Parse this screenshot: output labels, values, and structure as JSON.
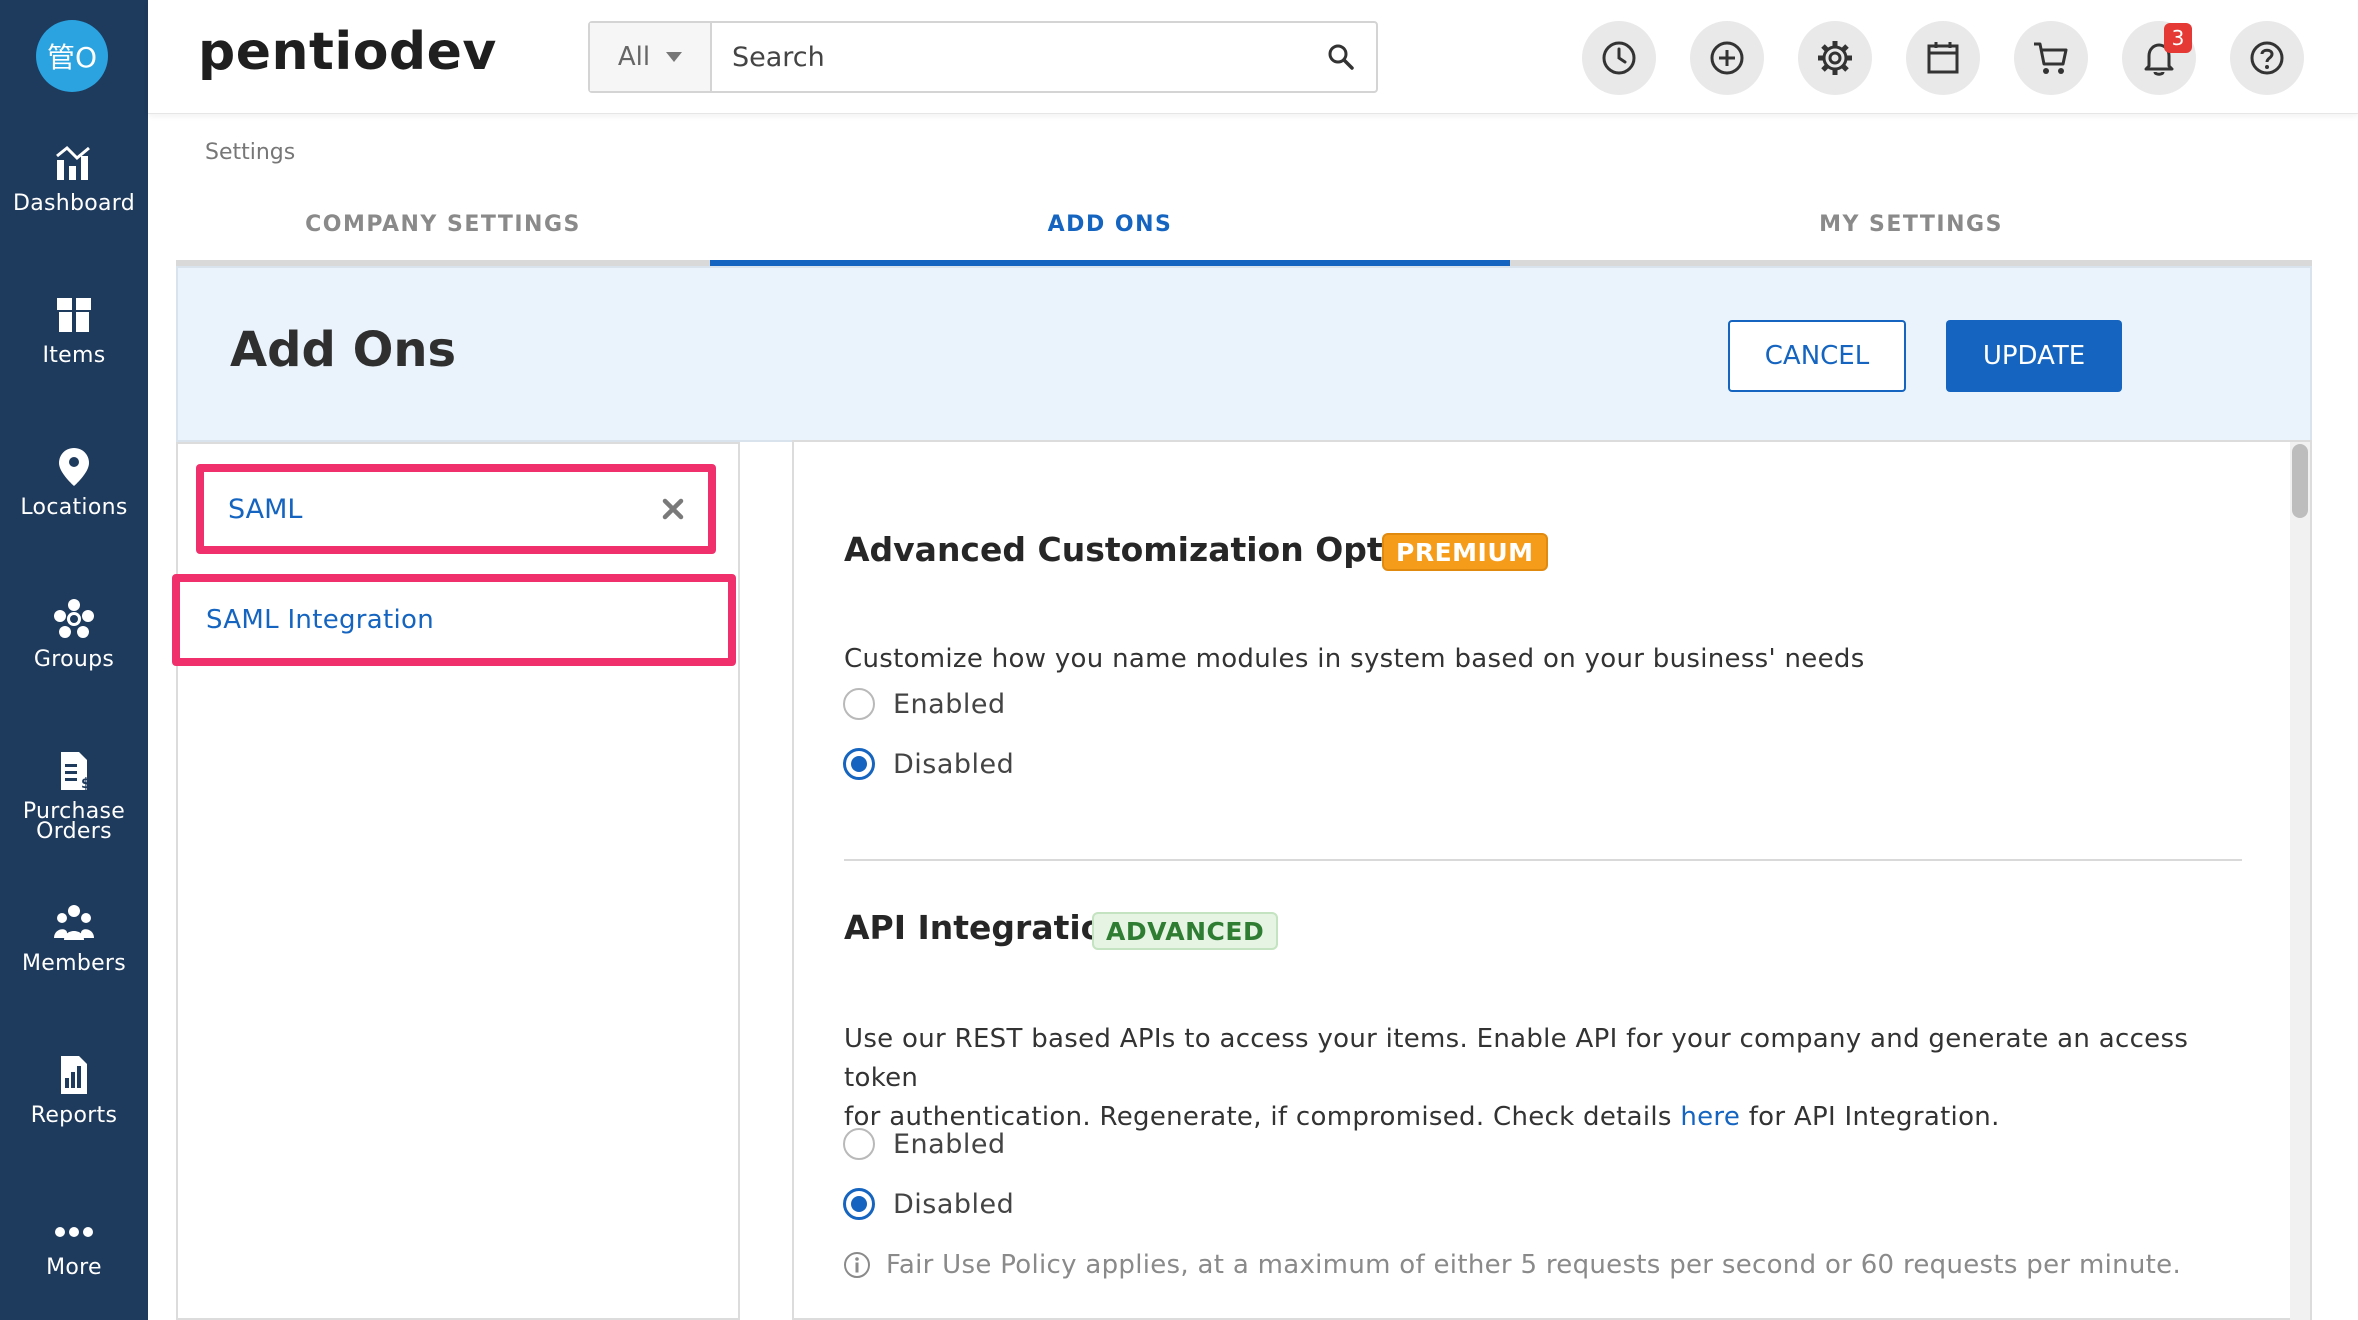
{
  "sidebar": {
    "logo_text": "管O",
    "items": [
      {
        "label": "Dashboard",
        "icon": "dashboard-icon"
      },
      {
        "label": "Items",
        "icon": "items-icon"
      },
      {
        "label": "Locations",
        "icon": "location-pin-icon"
      },
      {
        "label": "Groups",
        "icon": "groups-icon"
      },
      {
        "label": "Purchase Orders",
        "icon": "purchase-orders-icon"
      },
      {
        "label": "Members",
        "icon": "members-icon"
      },
      {
        "label": "Reports",
        "icon": "reports-icon"
      },
      {
        "label": "More",
        "icon": "more-dots-icon"
      }
    ]
  },
  "header": {
    "brand": "pentiodev",
    "search_scope": "All",
    "search_placeholder": "Search",
    "notification_count": "3",
    "icons": [
      "history-icon",
      "add-circle-icon",
      "gear-icon",
      "calendar-icon",
      "cart-icon",
      "bell-icon",
      "help-icon"
    ]
  },
  "breadcrumb": "Settings",
  "tabs": [
    {
      "label": "COMPANY SETTINGS",
      "active": false
    },
    {
      "label": "ADD ONS",
      "active": true
    },
    {
      "label": "MY SETTINGS",
      "active": false
    }
  ],
  "title_band": {
    "title": "Add Ons",
    "cancel_label": "CANCEL",
    "update_label": "UPDATE"
  },
  "filter": {
    "value": "SAML",
    "results": [
      "SAML Integration"
    ]
  },
  "sections": {
    "advanced_customization": {
      "title": "Advanced Customization Option",
      "tag": "PREMIUM",
      "description": "Customize how you name modules in system based on your business' needs",
      "options": [
        "Enabled",
        "Disabled"
      ],
      "selected": "Disabled"
    },
    "api_integration": {
      "title": "API Integration",
      "tag": "ADVANCED",
      "description_line1": "Use our REST based APIs to access your items. Enable API for your company and generate an access token",
      "description_line2_pre": "for authentication. Regenerate, if compromised. Check details ",
      "description_link": "here",
      "description_line2_post": " for API Integration.",
      "options": [
        "Enabled",
        "Disabled"
      ],
      "selected": "Disabled",
      "note": "Fair Use Policy applies, at a maximum of either 5 requests per second or 60 requests per minute."
    }
  },
  "colors": {
    "sidebar": "#1e3a5c",
    "accent": "#1565c0",
    "highlight": "#f0306c",
    "premium": "#f59c1a",
    "advanced_bg": "#e5f4e3",
    "advanced_text": "#2e7d32",
    "badge": "#e53935"
  }
}
